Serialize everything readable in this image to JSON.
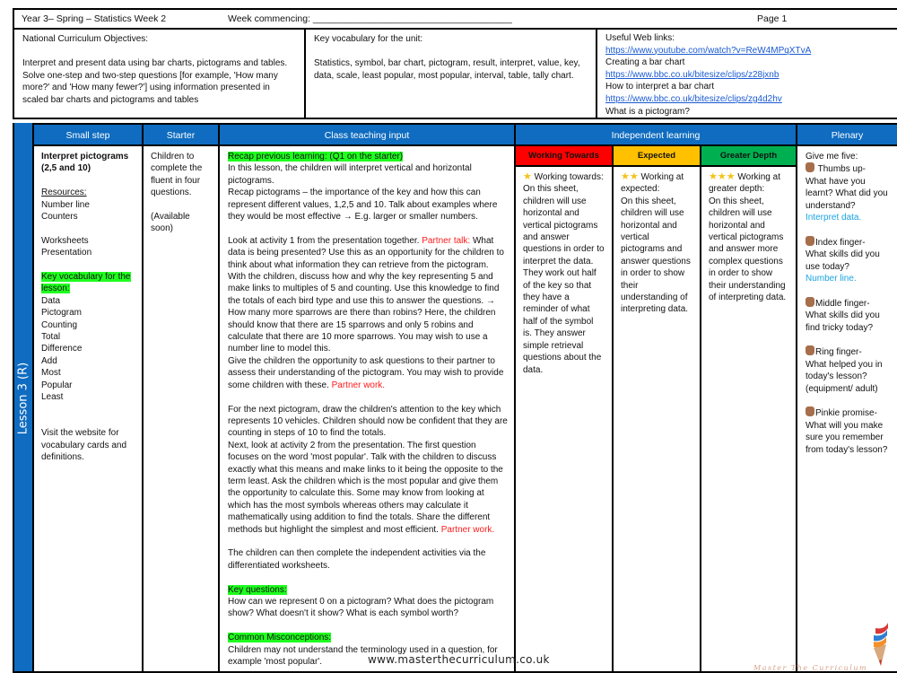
{
  "header": {
    "title": "Year 3– Spring – Statistics Week 2",
    "week_commencing_label": "Week commencing: ______________________________________",
    "page": "Page 1"
  },
  "objectives": {
    "heading": "National Curriculum Objectives:",
    "lines": [
      "Interpret and present data using bar charts, pictograms and tables.",
      "Solve one-step and two-step questions [for example, 'How many more?' and 'How many fewer?'] using information presented in scaled bar charts and pictograms and tables"
    ]
  },
  "vocab_unit": {
    "heading": "Key vocabulary for the unit:",
    "text": "Statistics, symbol, bar chart, pictogram, result, interpret, value, key, data, scale, least popular, most popular, interval, table, tally chart."
  },
  "web_links": {
    "heading": "Useful Web links:",
    "items": [
      {
        "type": "link",
        "text": "https://www.youtube.com/watch?v=ReW4MPqXTvA"
      },
      {
        "type": "label",
        "text": "Creating a bar chart"
      },
      {
        "type": "link",
        "text": "https://www.bbc.co.uk/bitesize/clips/z28jxnb"
      },
      {
        "type": "label",
        "text": "How to interpret a bar chart"
      },
      {
        "type": "link",
        "text": "https://www.bbc.co.uk/bitesize/clips/zg4d2hv"
      },
      {
        "type": "label",
        "text": "What is a pictogram?"
      }
    ]
  },
  "lesson_label": "Lesson 3 (R)",
  "columns": {
    "small_step": "Small step",
    "starter": "Starter",
    "class_teaching": "Class teaching input",
    "independent": "Independent learning",
    "plenary": "Plenary",
    "working_towards": "Working Towards",
    "expected": "Expected",
    "greater_depth": "Greater Depth"
  },
  "colors": {
    "header_blue": "#0f6cc0",
    "working_towards": "#ff0000",
    "expected": "#ffc000",
    "greater_depth": "#00b050",
    "highlight": "#1fff1f",
    "partner_red": "#ff1a1a",
    "plenary_blue": "#1aa3e0"
  },
  "small_step": {
    "title": "Interpret pictograms (2,5 and 10)",
    "resources_label": "Resources:",
    "resources": [
      "Number line",
      "Counters"
    ],
    "resources2": [
      "Worksheets",
      "Presentation"
    ],
    "vocab_label": "Key vocabulary for the lesson:",
    "vocab": [
      "Data",
      "Pictogram",
      "Counting",
      "Total",
      "Difference",
      "Add",
      "Most",
      "Popular",
      "Least"
    ],
    "visit_note": "Visit the website for vocabulary cards and definitions."
  },
  "starter": {
    "text": "Children to complete the fluent in four questions.",
    "note": "(Available soon)"
  },
  "teaching": {
    "recap_label": "Recap previous learning: (Q1 on the starter)",
    "p1": "In this lesson, the children will interpret vertical and horizontal pictograms.",
    "p2": "Recap pictograms – the importance of the key and how this can represent different values, 1,2,5 and 10. Talk about examples where they would be most effective → E.g. larger or smaller numbers.",
    "p3_a": "Look at activity 1 from the presentation together.  ",
    "p3_partner": "Partner talk:",
    "p3_b": " What data is being presented? Use this as an opportunity for the children to think about what information they can retrieve from the pictogram. With the children, discuss how and why the key representing 5 and make links to multiples of 5 and counting. Use this knowledge to find the totals of each bird type and use this to answer the questions. → How many more sparrows are there than robins? Here, the children should know that there are 15 sparrows and only 5 robins and calculate that there are 10 more sparrows. You may wish to use a number line to model this.",
    "p4_a": "Give the children the opportunity to ask questions to their partner to assess their understanding of the pictogram. You may wish to provide some children with these. ",
    "p4_partner": "Partner work.",
    "p5": "For the next pictogram, draw the children's attention to the key which represents 10 vehicles. Children should now be confident that they are counting in steps of 10 to find the totals.",
    "p6_a": "Next, look at activity 2 from the presentation. The first question focuses on the word 'most popular'. Talk with the children to discuss exactly what this means and make links to it being the opposite to the term least. Ask the children which is the most popular and give them the opportunity to calculate this. Some may know from looking at which has the most symbols whereas others may calculate it mathematically using addition to find the totals. Share the different methods but highlight the simplest and most efficient. ",
    "p6_partner": "Partner work.",
    "p7": "The children can then complete the independent activities via the differentiated worksheets.",
    "key_q_label": "Key questions:",
    "key_q": "How can we represent 0 on a pictogram? What does the pictogram show? What doesn't it show? What is each symbol worth?",
    "misc_label": "Common Misconceptions:",
    "misc": "Children may not understand the terminology used in a question, for example 'most popular'."
  },
  "independent": {
    "wt_stars": "★",
    "wt_text": "Working towards:",
    "wt_body": "On this sheet, children will use horizontal and vertical pictograms and answer questions in order to interpret the data. They work out half of the key so that they have a reminder of what half of the symbol is. They answer simple retrieval questions about the data.",
    "exp_stars": "★★",
    "exp_text": "Working at expected:",
    "exp_body": "On this sheet, children will use horizontal and vertical pictograms and answer questions in order to show their understanding of interpreting data.",
    "gd_stars": "★★★",
    "gd_text": "Working at greater depth:",
    "gd_body": "On this sheet, children will use horizontal and vertical pictograms and answer more complex questions in order to show their understanding of interpreting data."
  },
  "plenary": {
    "intro": "Give me five:",
    "items": [
      {
        "lead": "Thumbs up-",
        "q": "What have you learnt? What did you understand?",
        "answer": "Interpret data."
      },
      {
        "lead": "Index finger-",
        "q": "What skills did you use today?",
        "answer": "Number line."
      },
      {
        "lead": "Middle finger-",
        "q": "What skills did you find tricky today?",
        "answer": ""
      },
      {
        "lead": "Ring finger-",
        "q": "What helped you in today's lesson? (equipment/ adult)",
        "answer": ""
      },
      {
        "lead": "Pinkie promise-",
        "q": "What will you make sure you remember from today's lesson?",
        "answer": ""
      }
    ]
  },
  "footer": {
    "url": "www.masterthecurriculum.co.uk",
    "logo_text": "Master The Curriculum"
  }
}
